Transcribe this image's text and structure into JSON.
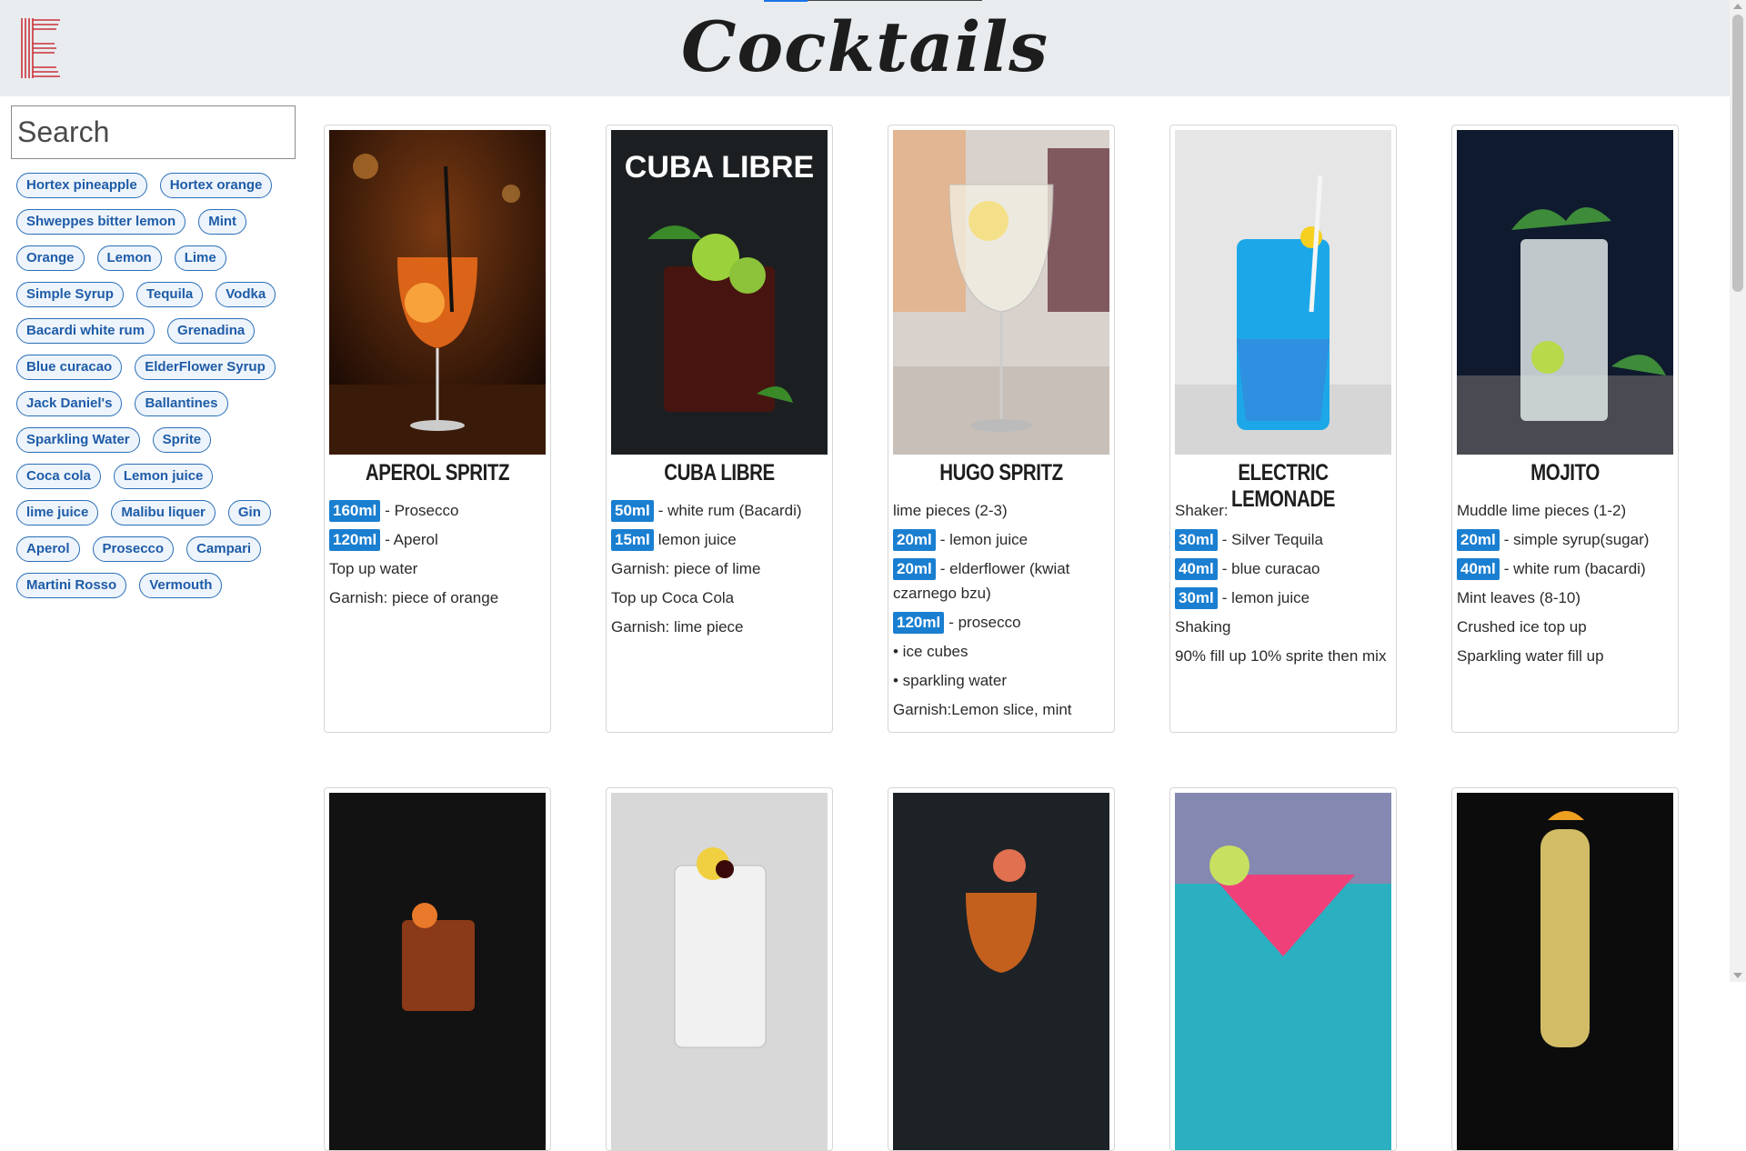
{
  "header": {
    "title": "Cocktails",
    "logo_icon": "striped-e-logo-icon"
  },
  "search": {
    "placeholder": "Search",
    "value": ""
  },
  "tags": [
    "Hortex pineapple",
    "Hortex orange",
    "Shweppes bitter lemon",
    "Mint",
    "Orange",
    "Lemon",
    "Lime",
    "Simple Syrup",
    "Tequila",
    "Vodka",
    "Bacardi white rum",
    "Grenadina",
    "Blue curacao",
    "ElderFlower Syrup",
    "Jack Daniel's",
    "Ballantines",
    "Sparkling Water",
    "Sprite",
    "Coca cola",
    "Lemon juice",
    "lime juice",
    "Malibu liquer",
    "Gin",
    "Aperol",
    "Prosecco",
    "Campari",
    "Martini Rosso",
    "Vermouth"
  ],
  "cards": [
    {
      "name": "APEROL SPRITZ",
      "image_icon": "aperol-spritz-photo-icon",
      "lines": [
        {
          "amount": "160ml",
          "text": "- Prosecco"
        },
        {
          "amount": "120ml",
          "text": "- Aperol"
        },
        {
          "amount": "",
          "text": "Top up water"
        },
        {
          "amount": "",
          "text": "Garnish: piece of orange"
        }
      ]
    },
    {
      "name": "CUBA LIBRE",
      "image_caption": "CUBA LIBRE",
      "image_icon": "cuba-libre-photo-icon",
      "lines": [
        {
          "amount": "50ml",
          "text": "- white rum (Bacardi)"
        },
        {
          "amount": "15ml",
          "text": "lemon juice"
        },
        {
          "amount": "",
          "text": "Garnish: piece of lime"
        },
        {
          "amount": "",
          "text": "Top up Coca Cola"
        },
        {
          "amount": "",
          "text": "Garnish: lime piece"
        }
      ]
    },
    {
      "name": "HUGO SPRITZ",
      "image_icon": "hugo-spritz-photo-icon",
      "lines": [
        {
          "amount": "",
          "text": "lime pieces (2-3)"
        },
        {
          "amount": "20ml",
          "text": "- lemon juice"
        },
        {
          "amount": "20ml",
          "text": "- elderflower (kwiat czarnego bzu)"
        },
        {
          "amount": "120ml",
          "text": "- prosecco"
        },
        {
          "amount": "",
          "text": "• ice cubes"
        },
        {
          "amount": "",
          "text": "• sparkling water"
        },
        {
          "amount": "",
          "text": "Garnish:Lemon slice, mint"
        }
      ]
    },
    {
      "name": "ELECTRIC LEMONADE",
      "image_icon": "electric-lemonade-photo-icon",
      "lines": [
        {
          "amount": "",
          "text": "Shaker:"
        },
        {
          "amount": "30ml",
          "text": "- Silver Tequila"
        },
        {
          "amount": "40ml",
          "text": "- blue curacao"
        },
        {
          "amount": "30ml",
          "text": "- lemon juice"
        },
        {
          "amount": "",
          "text": "Shaking"
        },
        {
          "amount": "",
          "text": "90% fill up 10% sprite then mix"
        }
      ]
    },
    {
      "name": "MOJITO",
      "image_icon": "mojito-photo-icon",
      "lines": [
        {
          "amount": "",
          "text": "Muddle lime pieces (1-2)"
        },
        {
          "amount": "20ml",
          "text": "- simple syrup(sugar)"
        },
        {
          "amount": "40ml",
          "text": "- white rum (bacardi)"
        },
        {
          "amount": "",
          "text": "Mint leaves (8-10)"
        },
        {
          "amount": "",
          "text": "Crushed ice top up"
        },
        {
          "amount": "",
          "text": "Sparkling water fill up"
        }
      ]
    }
  ],
  "second_row_images": [
    "old-fashioned-photo-icon",
    "gin-tonic-photo-icon",
    "negroni-photo-icon",
    "cosmopolitan-photo-icon",
    "french-75-photo-icon"
  ],
  "colors": {
    "header_bg": "#e9ecef",
    "tag_border": "#2a6fb8",
    "tag_text": "#1e5ca8",
    "amount_badge": "#1a7fd1"
  }
}
